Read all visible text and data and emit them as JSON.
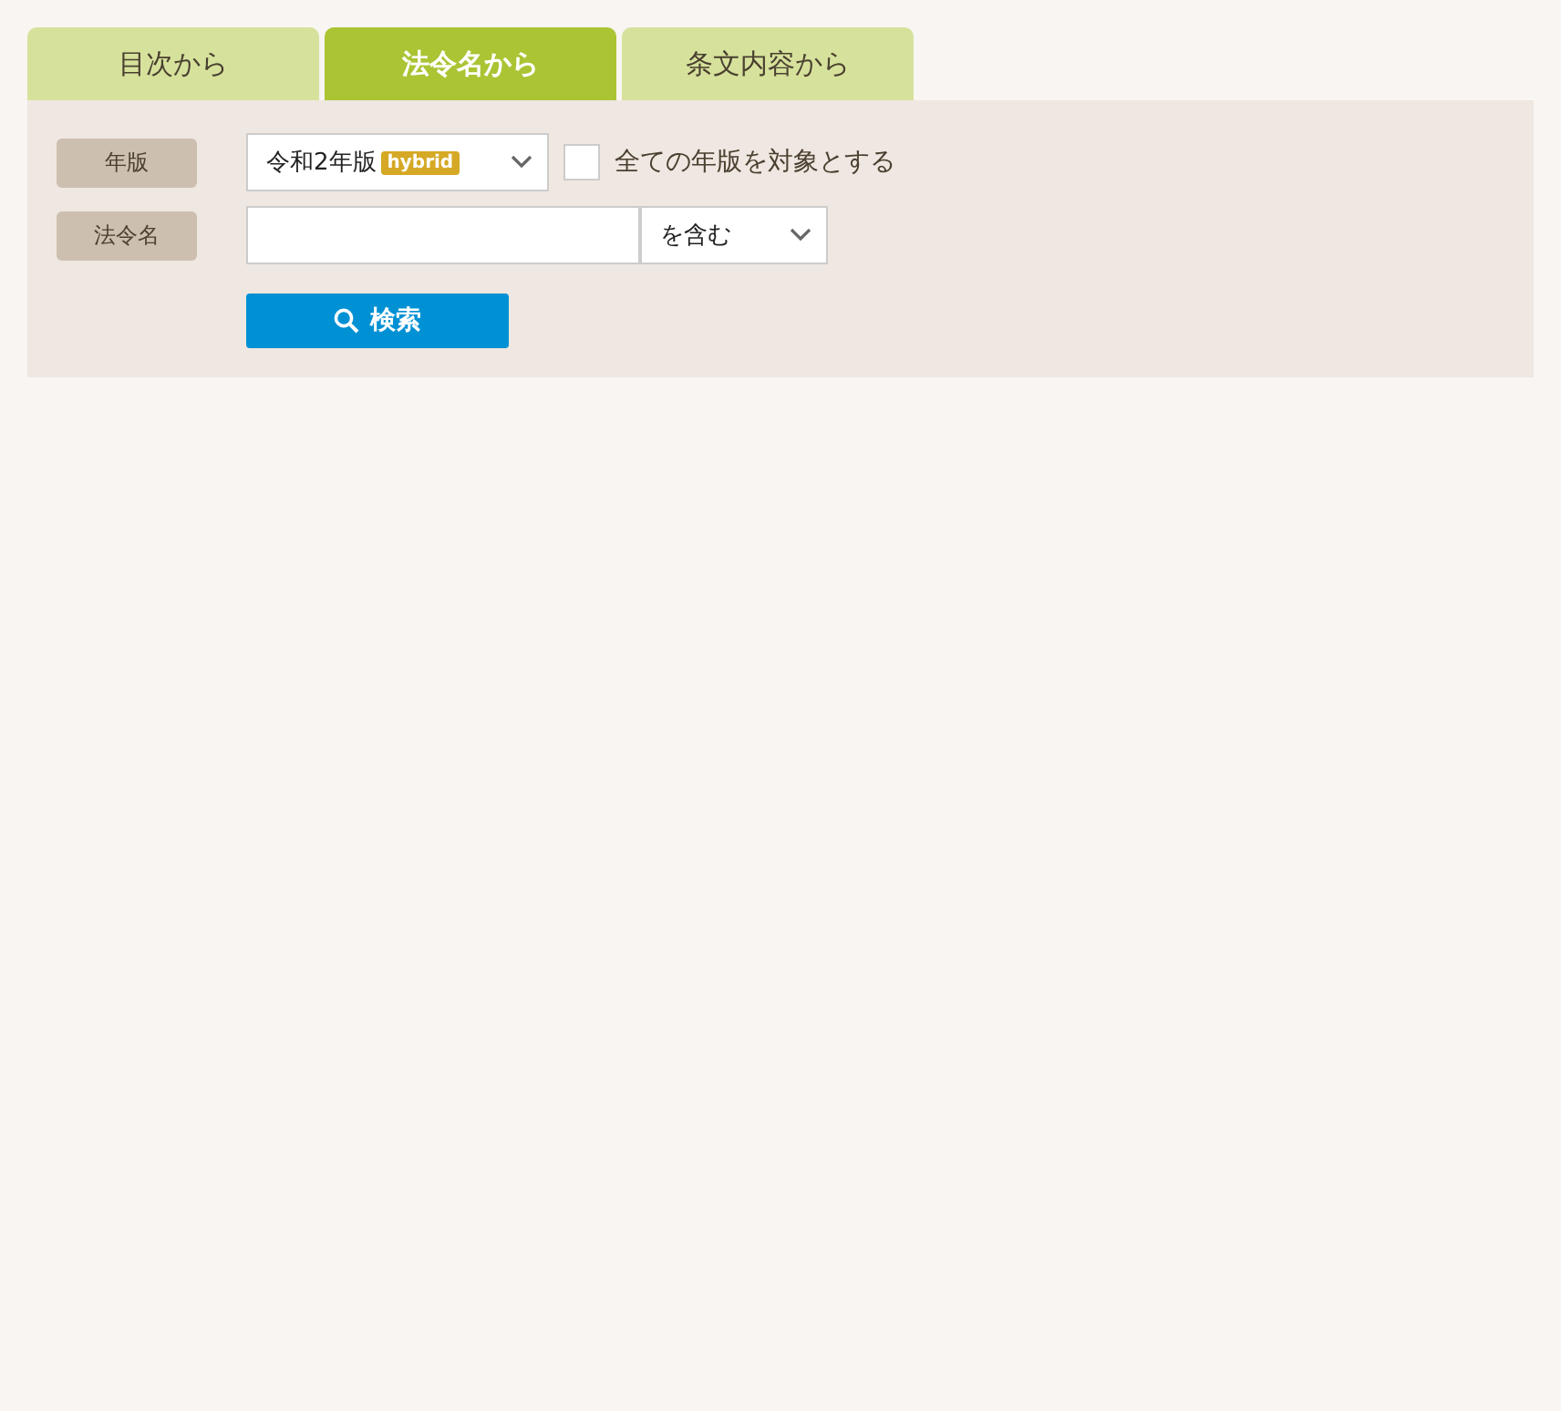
{
  "tabs": [
    {
      "label": "目次から",
      "selected": false
    },
    {
      "label": "法令名から",
      "selected": true
    },
    {
      "label": "条文内容から",
      "selected": false
    }
  ],
  "form": {
    "edition": {
      "label": "年版",
      "value": "令和2年版",
      "badge": "hybrid",
      "all_editions": {
        "label": "全ての年版を対象とする",
        "checked": false
      }
    },
    "law_name": {
      "label": "法令名",
      "match": "を含む"
    },
    "search_button": "検索"
  }
}
